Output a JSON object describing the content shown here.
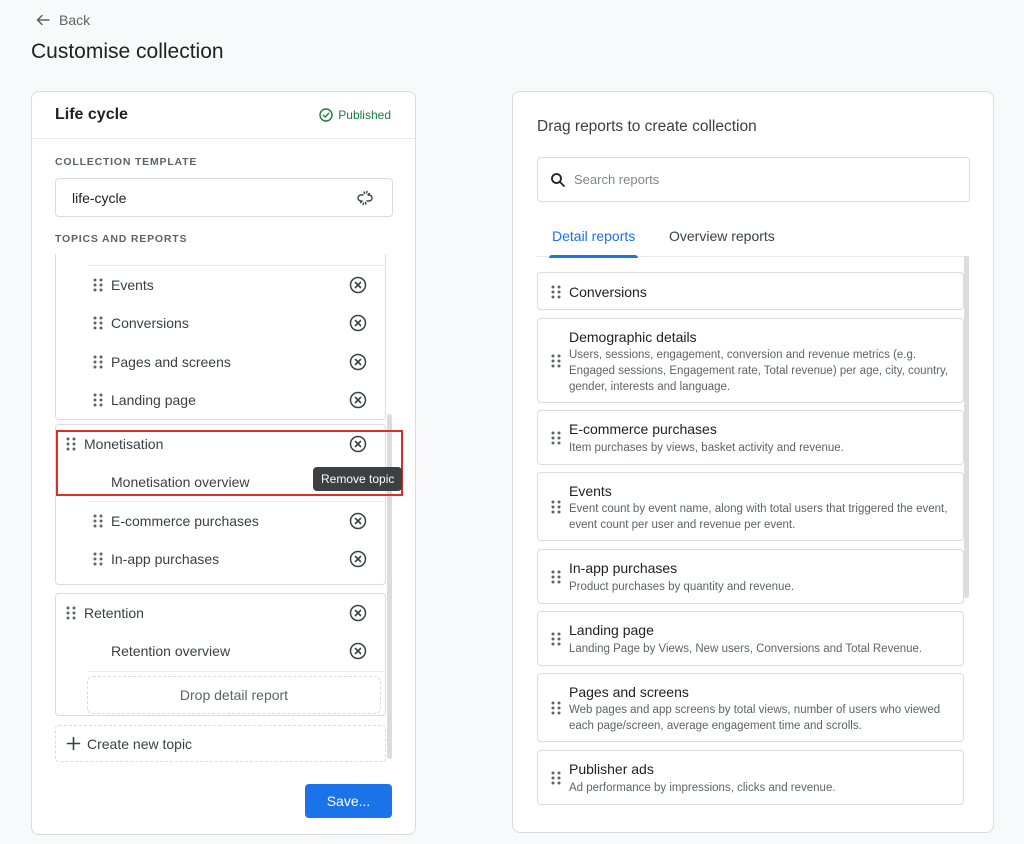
{
  "nav": {
    "back_label": "Back"
  },
  "page_title": "Customise collection",
  "collection": {
    "title": "Life cycle",
    "status": "Published",
    "template_label": "COLLECTION TEMPLATE",
    "template_value": "life-cycle",
    "topics_label": "TOPICS AND REPORTS",
    "topics": [
      {
        "name": null,
        "reports": [
          "Events",
          "Conversions",
          "Pages and screens",
          "Landing page"
        ]
      },
      {
        "name": "Monetisation",
        "overview": "Monetisation overview",
        "reports": [
          "E-commerce purchases",
          "In-app purchases"
        ]
      },
      {
        "name": "Retention",
        "overview": "Retention overview",
        "reports": [],
        "drop_placeholder": "Drop detail report"
      }
    ],
    "create_topic_label": "Create new topic",
    "tooltip": "Remove topic",
    "save_label": "Save..."
  },
  "library": {
    "title": "Drag reports to create collection",
    "search_placeholder": "Search reports",
    "search_value": "",
    "tabs": [
      {
        "label": "Detail reports",
        "active": true
      },
      {
        "label": "Overview reports",
        "active": false
      }
    ],
    "reports": [
      {
        "title": "Conversions",
        "description": ""
      },
      {
        "title": "Demographic details",
        "description": "Users, sessions, engagement, conversion and revenue metrics (e.g. Engaged sessions, Engagement rate, Total revenue) per age, city, country, gender, interests and language."
      },
      {
        "title": "E-commerce purchases",
        "description": "Item purchases by views, basket activity and revenue."
      },
      {
        "title": "Events",
        "description": "Event count by event name, along with total users that triggered the event, event count per user and revenue per event."
      },
      {
        "title": "In-app purchases",
        "description": "Product purchases by quantity and revenue."
      },
      {
        "title": "Landing page",
        "description": "Landing Page by Views, New users, Conversions and Total Revenue."
      },
      {
        "title": "Pages and screens",
        "description": "Web pages and app screens by total views, number of users who viewed each page/screen, average engagement time and scrolls."
      },
      {
        "title": "Publisher ads",
        "description": "Ad performance by impressions, clicks and revenue."
      }
    ]
  },
  "colors": {
    "accent": "#1a73e8",
    "published": "#188038",
    "highlight": "#d93025"
  }
}
